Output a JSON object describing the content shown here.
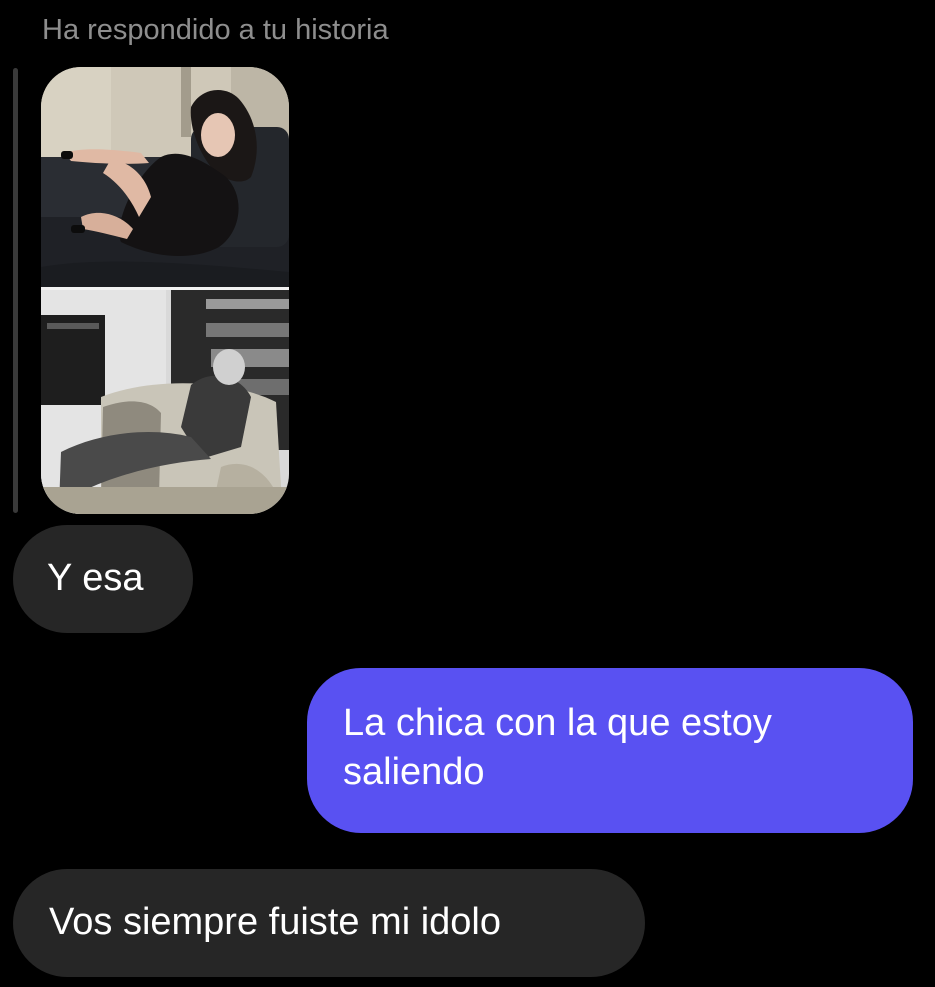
{
  "story_reply": {
    "label": "Ha respondido a tu historia",
    "thumbnail": {
      "top_photo": "woman-lounging-on-dark-sofa",
      "bottom_photo": "black-and-white-man-reclining-on-armchair"
    }
  },
  "messages": [
    {
      "direction": "received",
      "text": "Y esa"
    },
    {
      "direction": "sent",
      "text": "La chica con la que estoy saliendo"
    },
    {
      "direction": "received",
      "text": "Vos siempre fuiste mi idolo"
    }
  ],
  "colors": {
    "background": "#000000",
    "received_bubble": "#262626",
    "sent_bubble": "#5951f2",
    "secondary_text": "#8e8e8e",
    "text": "#ffffff"
  }
}
